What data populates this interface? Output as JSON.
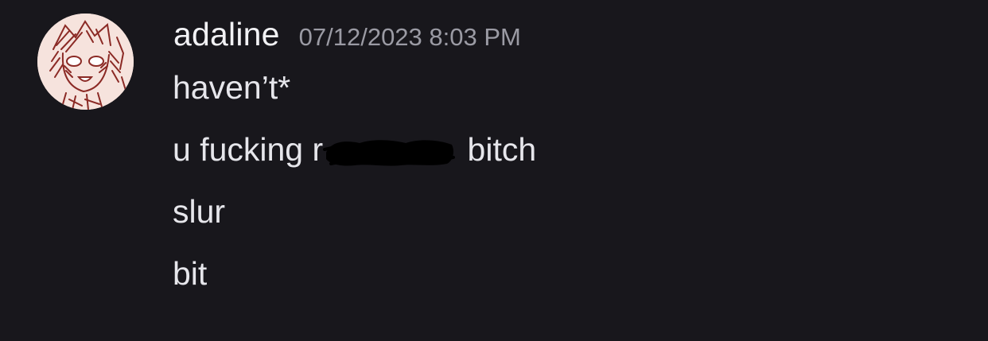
{
  "message_group": {
    "author": {
      "username": "adaline",
      "avatar_icon": "user-avatar-drawing"
    },
    "timestamp": "07/12/2023 8:03 PM",
    "messages": [
      {
        "text": "haven’t*"
      },
      {
        "text_before": "u fucking r",
        "redacted": true,
        "text_after": " bitch"
      },
      {
        "text": "slur"
      },
      {
        "text": "bit"
      }
    ]
  },
  "colors": {
    "background": "#18171c",
    "username": "#f2f2f5",
    "timestamp": "#9b9ba4",
    "message_text": "#e6e6eb",
    "avatar_bg": "#f6e3dd",
    "avatar_line": "#8b2a25"
  }
}
